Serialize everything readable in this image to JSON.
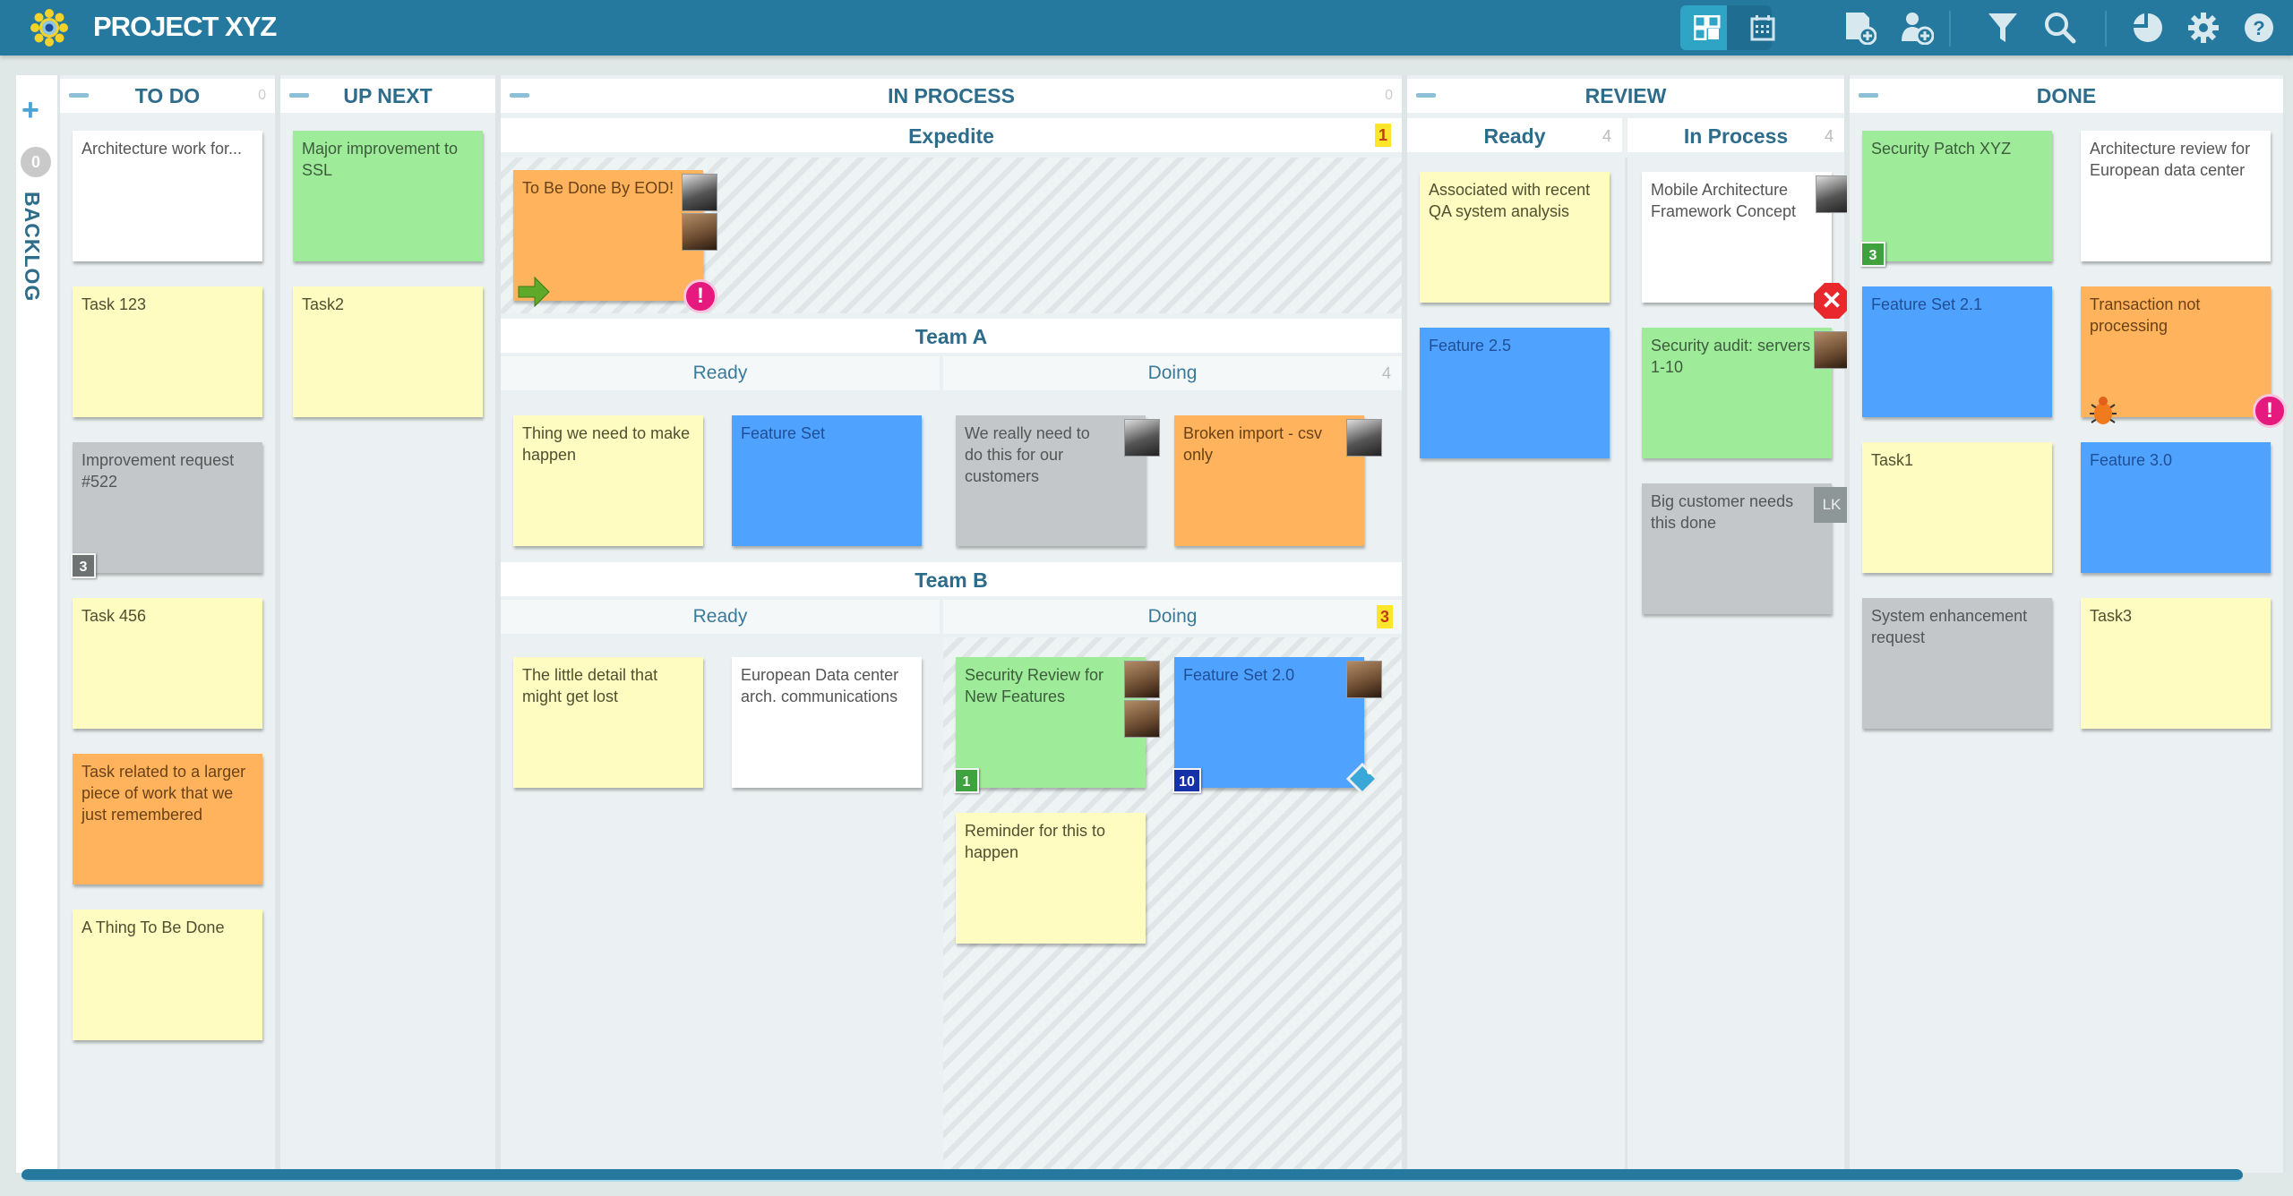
{
  "app": {
    "title": "PROJECT XYZ",
    "accent": "#25799e"
  },
  "toolbar": {
    "icons": [
      "board-view-icon",
      "calendar-view-icon",
      "add-card-icon",
      "add-user-icon",
      "filter-icon",
      "search-icon",
      "reports-icon",
      "settings-icon",
      "help-icon"
    ]
  },
  "backlog": {
    "label": "BACKLOG",
    "count": "0",
    "add": "+"
  },
  "columns": {
    "todo": {
      "title": "TO DO",
      "wip": "0",
      "cards": [
        {
          "text": "Architecture work for...",
          "color": "white"
        },
        {
          "text": "Task 123",
          "color": "yellow"
        },
        {
          "text": "Improvement request #522",
          "color": "gray",
          "badge": "3"
        },
        {
          "text": "Task 456",
          "color": "yellow"
        },
        {
          "text": "Task related to a larger piece of work that we just remembered",
          "color": "orange"
        },
        {
          "text": "A Thing To Be Done",
          "color": "yellow"
        }
      ]
    },
    "upnext": {
      "title": "UP NEXT",
      "cards": [
        {
          "text": "Major improvement to SSL",
          "color": "green"
        },
        {
          "text": "Task2",
          "color": "yellow"
        }
      ]
    },
    "inprocess": {
      "title": "IN PROCESS",
      "wip": "0",
      "expedite": {
        "title": "Expedite",
        "wip": "1",
        "cards": [
          {
            "text": "To Be Done By EOD!",
            "color": "orange"
          }
        ]
      },
      "teamA": {
        "title": "Team A",
        "ready": {
          "title": "Ready",
          "cards": [
            {
              "text": "Thing we need to make happen",
              "color": "yellow"
            },
            {
              "text": "Feature Set",
              "color": "blue"
            }
          ]
        },
        "doing": {
          "title": "Doing",
          "wip": "4",
          "cards": [
            {
              "text": "We really need to do this for our customers",
              "color": "gray"
            },
            {
              "text": "Broken import - csv only",
              "color": "orange"
            }
          ]
        }
      },
      "teamB": {
        "title": "Team B",
        "ready": {
          "title": "Ready",
          "cards": [
            {
              "text": "The little detail that might get lost",
              "color": "yellow"
            },
            {
              "text": "European Data center arch. communications",
              "color": "white"
            }
          ]
        },
        "doing": {
          "title": "Doing",
          "wip": "3",
          "cards": [
            {
              "text": "Security Review for New Features",
              "color": "green",
              "badge": "1"
            },
            {
              "text": "Feature Set 2.0",
              "color": "blue",
              "badge": "10"
            },
            {
              "text": "Reminder for this to happen",
              "color": "yellow"
            }
          ]
        }
      }
    },
    "review": {
      "title": "REVIEW",
      "ready": {
        "title": "Ready",
        "wip": "4",
        "cards": [
          {
            "text": "Associated with recent QA system analysis",
            "color": "yellow"
          },
          {
            "text": "Feature 2.5",
            "color": "blue"
          }
        ]
      },
      "inprocess": {
        "title": "In Process",
        "wip": "4",
        "cards": [
          {
            "text": "Mobile Architecture Framework Concept",
            "color": "white"
          },
          {
            "text": "Security audit: servers 1-10",
            "color": "green"
          },
          {
            "text": "Big customer needs this done",
            "color": "gray",
            "initials": "LK"
          }
        ]
      }
    },
    "done": {
      "title": "DONE",
      "cards": [
        {
          "text": "Security Patch XYZ",
          "color": "green",
          "badge": "3"
        },
        {
          "text": "Architecture review for European data center",
          "color": "white"
        },
        {
          "text": "Feature Set 2.1",
          "color": "blue"
        },
        {
          "text": "Transaction not processing",
          "color": "orange"
        },
        {
          "text": "Task1",
          "color": "yellow"
        },
        {
          "text": "Feature 3.0",
          "color": "blue"
        },
        {
          "text": "System enhancement request",
          "color": "gray"
        },
        {
          "text": "Task3",
          "color": "yellow"
        }
      ]
    }
  },
  "icons": {
    "alert": "!",
    "blocked": "✕"
  }
}
